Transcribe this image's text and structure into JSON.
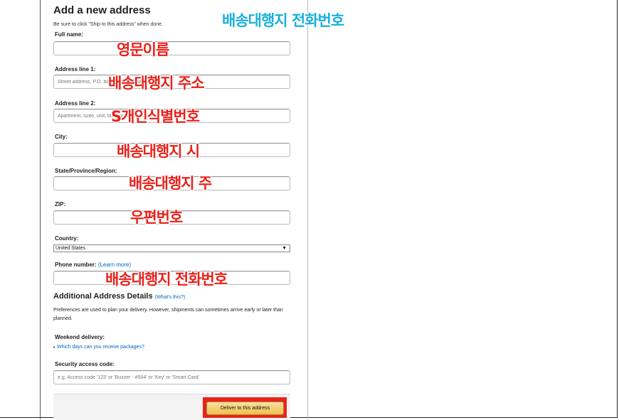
{
  "form": {
    "title": "Add a new address",
    "subtitle": "Be sure to click \"Ship to this address\" when done.",
    "full_name_label": "Full name:",
    "address1_label": "Address line 1:",
    "address1_placeholder": "Street address, P.O. box, company name, c/o",
    "address2_label": "Address line 2:",
    "address2_placeholder": "Apartment, suite, unit, building, floor, etc.",
    "city_label": "City:",
    "state_label": "State/Province/Region:",
    "zip_label": "ZIP:",
    "country_label": "Country:",
    "country_selected": "United States",
    "phone_label": "Phone number:",
    "phone_learn_more": "(Learn more)",
    "additional_title": "Additional Address Details",
    "whats_this": "(What's this?)",
    "preferences_text": "Preferences are used to plan your delivery. However, shipments can sometimes arrive early or later than planned.",
    "weekend_label": "Weekend delivery:",
    "weekend_link": "Which days can you receive packages?",
    "security_label": "Security access code:",
    "security_placeholder": "e.g. Access code '123' or 'Buzzer - #504' or 'Key' or 'Smart Card'",
    "deliver_button": "Deliver to this address"
  },
  "annotations": {
    "top_blue": "배송대행지 전화번호",
    "full_name": "영문이름",
    "address1": "배송대행지 주소",
    "address2": "S개인식별번호",
    "city": "배송대행지 시",
    "state": "배송대행지 주",
    "zip": "우편번호",
    "phone": "배송대행지 전화번호"
  },
  "colors": {
    "annotation_red": "#e8231c",
    "annotation_blue": "#19b0dd",
    "link": "#0066c0",
    "button": "#f0c14b"
  },
  "icons": {
    "select_arrow": "triangle-down",
    "weekend_arrow": "triangle-right"
  }
}
